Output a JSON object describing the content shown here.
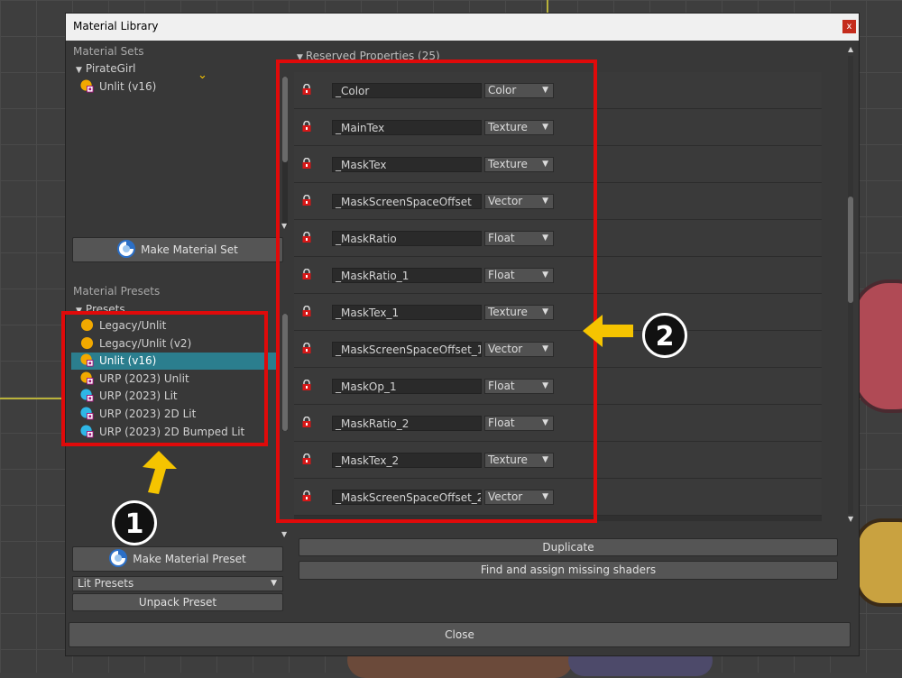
{
  "window": {
    "title": "Material Library",
    "close_glyph": "x"
  },
  "material_sets": {
    "section_label": "Material Sets",
    "tree": {
      "root": "PirateGirl",
      "child": "Unlit (v16)"
    },
    "make_button": "Make Material Set"
  },
  "material_presets": {
    "section_label": "Material Presets",
    "group": "Presets",
    "items": [
      {
        "label": "Legacy/Unlit",
        "icon": "yellow-circle-icon"
      },
      {
        "label": "Legacy/Unlit (v2)",
        "icon": "yellow-circle-icon"
      },
      {
        "label": "Unlit (v16)",
        "icon": "yellow-material-icon"
      },
      {
        "label": "URP (2023) Unlit",
        "icon": "yellow-material-icon"
      },
      {
        "label": "URP (2023) Lit",
        "icon": "cyan-material-icon"
      },
      {
        "label": "URP (2023) 2D Lit",
        "icon": "cyan-material-icon"
      },
      {
        "label": "URP (2023) 2D Bumped Lit",
        "icon": "cyan-material-icon"
      }
    ],
    "selected_index": 2,
    "make_button": "Make Material Preset",
    "dropdown_value": "Lit Presets",
    "unpack_button": "Unpack Preset"
  },
  "reserved": {
    "header": "Reserved Properties (25)",
    "properties": [
      {
        "name": "_Color",
        "type": "Color"
      },
      {
        "name": "_MainTex",
        "type": "Texture"
      },
      {
        "name": "_MaskTex",
        "type": "Texture"
      },
      {
        "name": "_MaskScreenSpaceOffset",
        "type": "Vector"
      },
      {
        "name": "_MaskRatio",
        "type": "Float"
      },
      {
        "name": "_MaskRatio_1",
        "type": "Float"
      },
      {
        "name": "_MaskTex_1",
        "type": "Texture"
      },
      {
        "name": "_MaskScreenSpaceOffset_1",
        "type": "Vector"
      },
      {
        "name": "_MaskOp_1",
        "type": "Float"
      },
      {
        "name": "_MaskRatio_2",
        "type": "Float"
      },
      {
        "name": "_MaskTex_2",
        "type": "Texture"
      },
      {
        "name": "_MaskScreenSpaceOffset_2",
        "type": "Vector"
      }
    ]
  },
  "actions": {
    "duplicate": "Duplicate",
    "find_shaders": "Find and assign missing shaders",
    "close": "Close"
  },
  "annotations": {
    "badge_1": "1",
    "badge_2": "2"
  },
  "colors": {
    "highlight": "#e00a0a",
    "arrow": "#f5c400",
    "selection": "#2b7e8e"
  }
}
